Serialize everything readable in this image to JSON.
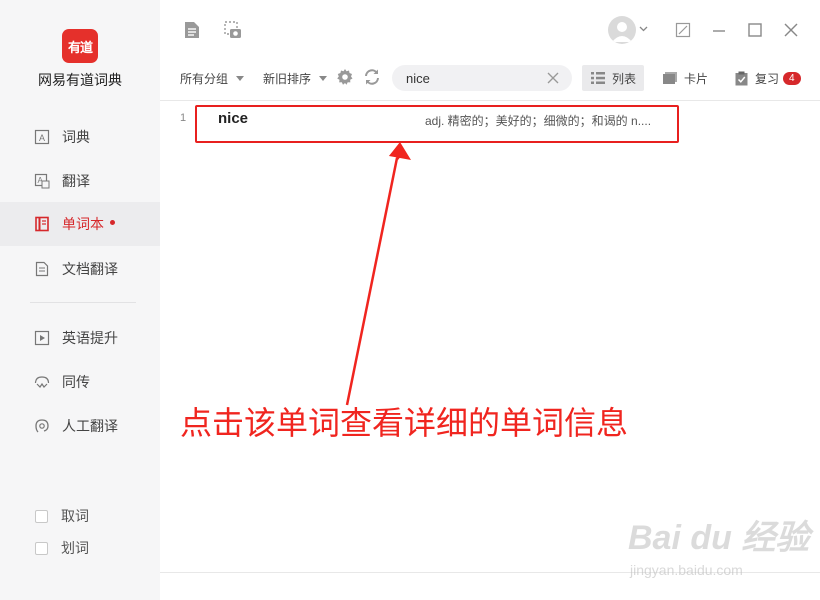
{
  "app": {
    "logo_text": "有道",
    "name": "网易有道词典"
  },
  "sidebar": {
    "items": [
      {
        "label": "词典",
        "icon": "dictionary-icon"
      },
      {
        "label": "翻译",
        "icon": "translate-icon"
      },
      {
        "label": "单词本",
        "icon": "wordbook-icon",
        "active": true
      },
      {
        "label": "文档翻译",
        "icon": "document-translate-icon"
      },
      {
        "label": "英语提升",
        "icon": "video-play-icon"
      },
      {
        "label": "同传",
        "icon": "simultaneous-interpretation-icon"
      },
      {
        "label": "人工翻译",
        "icon": "human-translation-icon"
      }
    ],
    "checks": [
      {
        "label": "取词",
        "checked": false
      },
      {
        "label": "划词",
        "checked": false
      }
    ]
  },
  "toolbar": {
    "group_label": "所有分组",
    "sort_label": "新旧排序",
    "search_value": "nice",
    "list_label": "列表",
    "card_label": "卡片",
    "review_label": "复习",
    "review_count": "4"
  },
  "words": [
    {
      "index": "1",
      "word": "nice",
      "definition": "adj. 精密的；美好的；细微的；和谒的 n...."
    }
  ],
  "annotation": "点击该单词查看详细的单词信息",
  "watermark": {
    "brand": "Bai du 经验",
    "url": "jingyan.baidu.com"
  },
  "colors": {
    "accent": "#d6282b",
    "annotation": "#f0251f",
    "sidebar_bg": "#f6f6f7"
  }
}
